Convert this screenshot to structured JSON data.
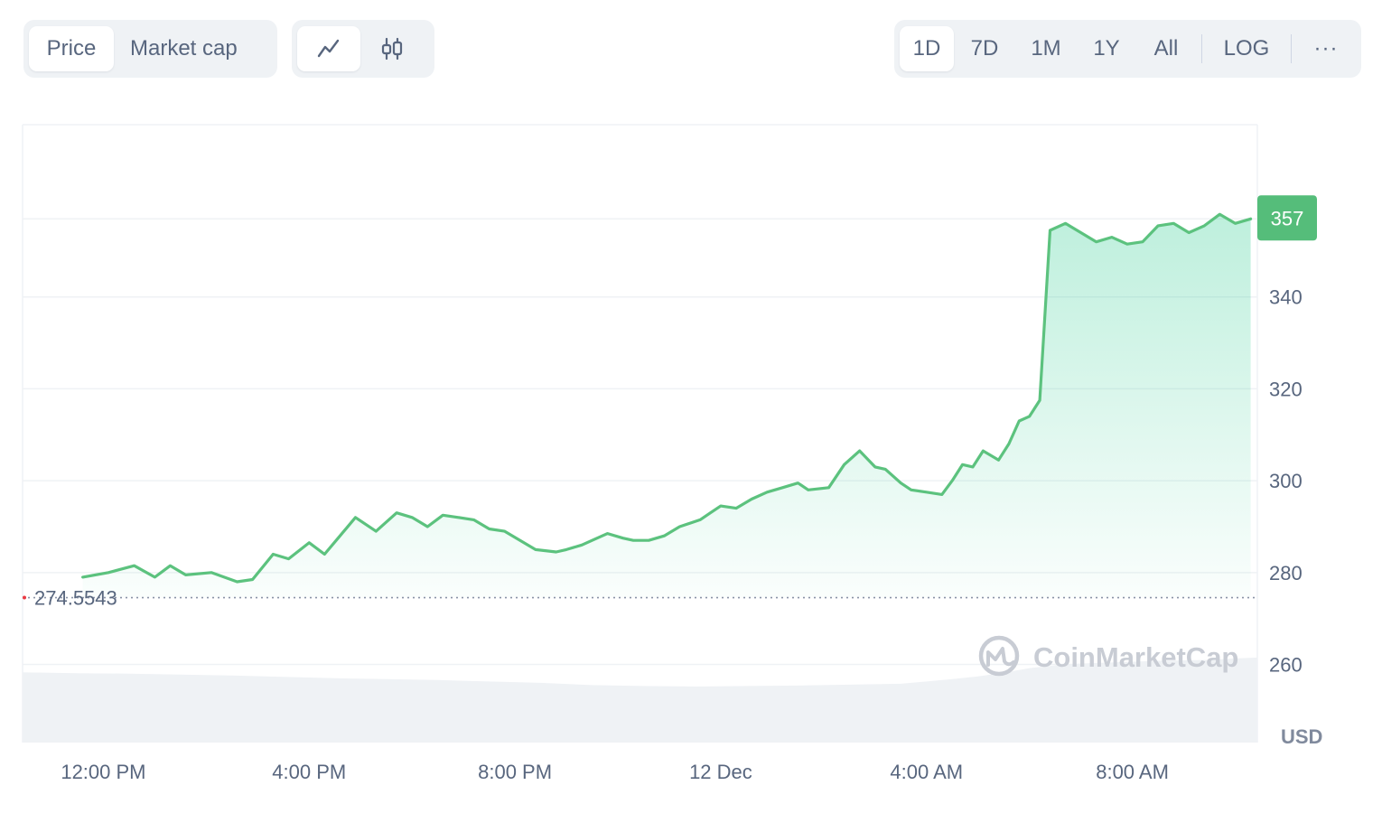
{
  "toolbar": {
    "metric_tabs": [
      {
        "label": "Price",
        "active": true
      },
      {
        "label": "Market cap",
        "active": false
      }
    ],
    "chart_types": [
      {
        "icon": "line-chart-icon",
        "active": true
      },
      {
        "icon": "candlestick-icon",
        "active": false
      }
    ],
    "ranges": [
      {
        "label": "1D",
        "active": true
      },
      {
        "label": "7D",
        "active": false
      },
      {
        "label": "1M",
        "active": false
      },
      {
        "label": "1Y",
        "active": false
      },
      {
        "label": "All",
        "active": false
      }
    ],
    "log_label": "LOG",
    "more_label": "···"
  },
  "colors": {
    "line": "#16c784",
    "line_stroke": "#5cc27e",
    "badge_bg": "#55bd7a",
    "grid": "#eff2f5",
    "axis_text": "#58667e",
    "volume": "#eff2f5",
    "watermark": "#c8ccd4"
  },
  "watermark_text": "CoinMarketCap",
  "chart_data": {
    "type": "area",
    "currency_label": "USD",
    "current_price_label": "357",
    "open_price_label": "274.5543",
    "open_price": 274.5543,
    "ylim": [
      243,
      377.5
    ],
    "y_ticks": [
      260,
      280,
      300,
      320,
      340
    ],
    "grid_lines": [
      260,
      280,
      300,
      320,
      340,
      357,
      377.5
    ],
    "x_range": [
      10.43,
      34.43
    ],
    "x_ticks": [
      {
        "value": 12,
        "label": "12:00 PM"
      },
      {
        "value": 16,
        "label": "4:00 PM"
      },
      {
        "value": 20,
        "label": "8:00 PM"
      },
      {
        "value": 24,
        "label": "12 Dec"
      },
      {
        "value": 28,
        "label": "4:00 AM"
      },
      {
        "value": 32,
        "label": "8:00 AM"
      }
    ],
    "series": [
      {
        "x": [
          11.6,
          12.1,
          12.6,
          13.0,
          13.3,
          13.6,
          14.1,
          14.6,
          14.9,
          15.3,
          15.6,
          16.0,
          16.3,
          16.6,
          16.9,
          17.3,
          17.7,
          18.0,
          18.3,
          18.6,
          18.9,
          19.2,
          19.5,
          19.8,
          20.1,
          20.4,
          20.8,
          21.0,
          21.3,
          21.5,
          21.8,
          22.1,
          22.3,
          22.6,
          22.9,
          23.2,
          23.6,
          23.8,
          24.0,
          24.3,
          24.6,
          24.9,
          25.2,
          25.5,
          25.7,
          26.1,
          26.4,
          26.7,
          27.0,
          27.2,
          27.5,
          27.7,
          28.0,
          28.3,
          28.5,
          28.7,
          28.9,
          29.1,
          29.4,
          29.6,
          29.8,
          30.0,
          30.2,
          30.4,
          30.6,
          30.9,
          31.2,
          31.5,
          31.8,
          32.2,
          32.5,
          32.8,
          33.1,
          33.4,
          33.7,
          34.0,
          34.3
        ],
        "values": [
          279,
          280,
          281.5,
          279,
          281.5,
          279.5,
          280,
          278,
          278.5,
          284,
          283,
          286.5,
          284,
          288,
          292,
          289,
          293,
          292,
          290,
          292.5,
          292,
          291.5,
          289.5,
          289,
          287,
          285,
          284.5,
          285,
          286,
          287,
          288.5,
          287.5,
          287,
          287,
          288,
          290,
          291.5,
          293,
          294.5,
          294,
          296,
          297.5,
          298.5,
          299.5,
          298,
          298.5,
          303.5,
          306.5,
          303,
          302.5,
          299.5,
          298,
          297.5,
          297,
          300,
          303.5,
          303,
          306.5,
          304.5,
          308,
          313,
          314,
          317.5,
          324,
          327.5,
          332.5,
          342,
          346.5,
          343.5,
          348.5,
          343.5,
          347,
          356.5,
          354.5,
          352.5,
          355.5,
          353.5
        ]
      },
      {
        "x": [
          30.4,
          30.7,
          31.0,
          31.3,
          31.6,
          31.9,
          32.2,
          32.5,
          32.8,
          33.1,
          33.4,
          33.7,
          34.0,
          34.3
        ],
        "values": [
          354.5,
          356,
          354,
          352,
          353,
          351.5,
          352,
          355.5,
          356,
          354,
          355.5,
          358,
          356,
          357
        ]
      }
    ],
    "volume": {
      "x": [
        10.43,
        11.5,
        12.5,
        13.5,
        14.5,
        15.5,
        16.5,
        17.5,
        18.5,
        19.5,
        20.5,
        21.5,
        22.5,
        23.5,
        24.5,
        25.5,
        26.5,
        27.5,
        28.0,
        28.5,
        29.0,
        29.5,
        30.0,
        30.5,
        31.0,
        31.5,
        32.0,
        32.5,
        33.0,
        33.5,
        34.0,
        34.43
      ],
      "values": [
        258.3,
        258.1,
        258.0,
        257.8,
        257.6,
        257.3,
        257.0,
        256.8,
        256.6,
        256.3,
        256.0,
        255.5,
        255.3,
        255.2,
        255.3,
        255.4,
        255.6,
        255.8,
        256.3,
        256.8,
        257.4,
        258.2,
        259.2,
        259.8,
        260.2,
        260.4,
        260.6,
        260.8,
        260.9,
        261.0,
        261.3,
        261.5
      ]
    }
  }
}
